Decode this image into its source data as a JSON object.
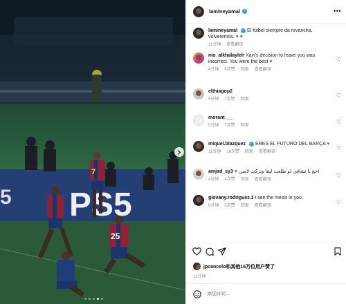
{
  "post": {
    "username": "lamineyamal",
    "photo": {
      "board_text": "PS5",
      "jersey_numbers": [
        "7",
        "25"
      ]
    }
  },
  "comments": [
    {
      "user": "lamineyamal",
      "verified": true,
      "text": "El fútbol siempre da revancha, volveremos.",
      "emoji": [
        "♥",
        "♥"
      ],
      "time": "11分钟",
      "actions": [
        "查看翻译"
      ]
    },
    {
      "user": "mo_alkhalayleh",
      "text": "Xavi's decision to leave you was incorrect. You were the best",
      "emoji": [
        "♥"
      ],
      "time": "4分钟",
      "actions": [
        "6次赞",
        "回复",
        "查看翻译"
      ]
    },
    {
      "user": "elthiagop2",
      "text": "",
      "time": "5分钟",
      "actions": [
        "7次赞",
        "回复"
      ]
    },
    {
      "user": "morant___",
      "text": "",
      "time": "5分钟",
      "actions": [
        "7次赞",
        "回复"
      ]
    },
    {
      "user": "miquel.blazquez",
      "verified": true,
      "text": "ERES EL FUTURO DEL BARÇA",
      "emoji": [
        "♥"
      ],
      "time": "11分钟",
      "actions": [
        "18次赞",
        "回复",
        "查看翻译"
      ]
    },
    {
      "user": "amjad_sy3",
      "text": "احچ يا تشافي لو طلعت ليڤا وتركت لامين",
      "emoji": [
        "♥"
      ],
      "time": "4分钟",
      "actions": [
        "4次赞",
        "回复",
        "查看翻译"
      ]
    },
    {
      "user": "giovany.rodriguez.1",
      "text": "i see the messi in you.",
      "time": "9分钟",
      "actions": [
        "5次赞",
        "回复",
        "查看翻译"
      ]
    }
  ],
  "likes": {
    "user": "jpcancelo",
    "rest": "和其他16万位用户赞了"
  },
  "post_time": "11分钟",
  "comment_input": {
    "placeholder": "添加评论..."
  },
  "carousel": {
    "total": 5,
    "active": 4
  }
}
